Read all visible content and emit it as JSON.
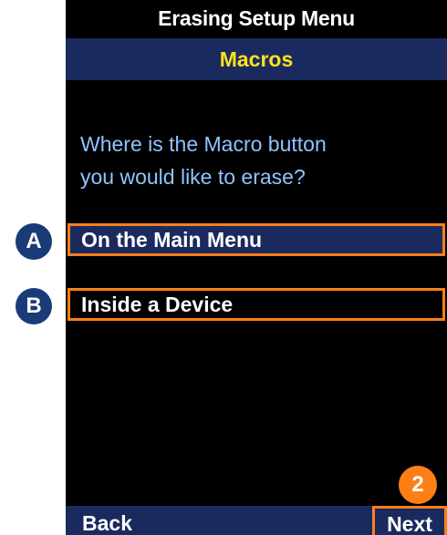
{
  "screen": {
    "title": "Erasing Setup Menu",
    "subtitle": "Macros",
    "prompt_line1": "Where is the Macro button",
    "prompt_line2": "you would like to erase?"
  },
  "options": [
    {
      "label": "On the Main Menu",
      "badge": "A",
      "selected": true
    },
    {
      "label": "Inside a Device",
      "badge": "B",
      "selected": false
    }
  ],
  "softkeys": {
    "back_label": "Back",
    "next_label": "Next"
  },
  "step_badge": "2",
  "colors": {
    "screen_background": "#000000",
    "bar_navy": "#1b2a5e",
    "subtitle_yellow": "#ffe21a",
    "prompt_blue": "#8fc4ff",
    "highlight_orange": "#ff7f17",
    "badge_navy": "#1b3a78"
  }
}
